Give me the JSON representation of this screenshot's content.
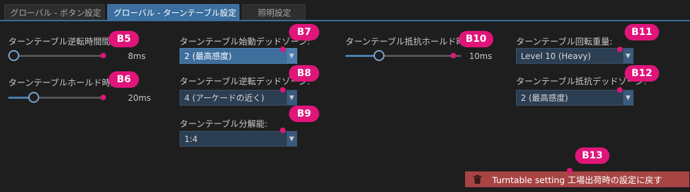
{
  "tabs": [
    {
      "label": "グローバル - ボタン設定"
    },
    {
      "label": "グローバル - ターンテーブル設定"
    },
    {
      "label": "照明設定"
    }
  ],
  "col1": {
    "reverse_time": {
      "label": "ターンテーブル逆転時間間隔",
      "value": "8ms",
      "level": 0.0
    },
    "hold_time": {
      "label": "ターンテーブルホールド時間",
      "value": "20ms",
      "level": 0.25
    }
  },
  "col2": {
    "start_deadzone": {
      "label": "ターンテーブル始動デッドゾーン:",
      "value": "2 (最高感度)"
    },
    "reverse_deadzone": {
      "label": "ターンテーブル逆転デッドゾーン:",
      "value": "4 (アーケードの近く)"
    },
    "resolution": {
      "label": "ターンテーブル分解能:",
      "value": "1:4"
    }
  },
  "col3": {
    "resist_hold": {
      "label": "ターンテーブル抵抗ホールド時間",
      "value": "10ms",
      "level": 0.3
    }
  },
  "col4": {
    "rotation_weight": {
      "label": "ターンテーブル回転重量:",
      "value": "Level 10 (Heavy)"
    },
    "resist_deadzone": {
      "label": "ターンテーブル抵抗デッドゾーン:",
      "value": "2 (最高感度)"
    }
  },
  "badges": {
    "b5": "B5",
    "b6": "B6",
    "b7": "B7",
    "b8": "B8",
    "b9": "B9",
    "b10": "B10",
    "b11": "B11",
    "b12": "B12",
    "b13": "B13"
  },
  "reset": {
    "label": "Turntable setting 工場出荷時の設定に戻す",
    "icon": "trash-icon"
  },
  "colors": {
    "accent": "#3a6fa0",
    "badge": "#e0157a",
    "reset": "#a84444"
  }
}
